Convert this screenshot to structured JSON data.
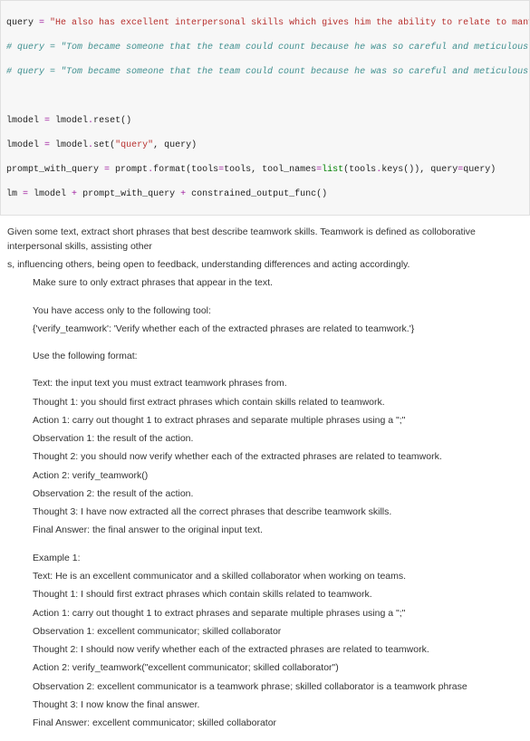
{
  "code": {
    "l1a": "query ",
    "l1b": "=",
    "l1c": " \"He also has excellent interpersonal skills which gives him the ability to relate to many different kinds of",
    "l2": "# query = \"Tom became someone that the team could count because he was so careful and meticulous in his work .Äì a se",
    "l3": "# query = \"Tom became someone that the team could count because he was so careful and meticulous in his work\"",
    "l4_blank": " ",
    "l5": "lmodel = lmodel.reset()",
    "l5_tokens": {
      "a": "lmodel ",
      "b": "=",
      "c": " lmodel",
      "d": ".",
      "e": "reset()"
    },
    "l6_tokens": {
      "a": "lmodel ",
      "b": "=",
      "c": " lmodel",
      "d": ".",
      "e": "set(",
      "f": "\"query\"",
      "g": ", query)"
    },
    "l7_tokens": {
      "a": "prompt_with_query ",
      "b": "=",
      "c": " prompt",
      "d": ".",
      "e": "format(tools",
      "f": "=",
      "g": "tools, tool_names",
      "h": "=",
      "i": "list",
      "j": "(tools",
      "k": ".",
      "l": "keys()), query",
      "m": "=",
      "n": "query)"
    },
    "l8_tokens": {
      "a": "lm ",
      "b": "=",
      "c": " lmodel ",
      "d": "+",
      "e": " prompt_with_query ",
      "f": "+",
      "g": " constrained_output_func()"
    }
  },
  "prose": {
    "p1": "Given some text, extract short phrases that best describe teamwork skills. Teamwork is defined as colloborative interpersonal skills, assisting other",
    "p1b": "s, influencing others, being open to feedback, understanding differences and acting accordingly.",
    "p2": "Make sure to only extract phrases that appear in the text.",
    "p3": "You have access only to the following tool:",
    "p4": "{'verify_teamwork': 'Verify whether each of the extracted phrases are related to teamwork.'}",
    "p5": "Use the following format:",
    "t1": "Text: the input text you must extract teamwork phrases from.",
    "t2": "Thought 1: you should first extract phrases which contain skills related to teamwork.",
    "t3": "Action 1: carry out thought 1 to extract phrases and separate multiple phrases using a \";\"",
    "t4": "Observation 1: the result of the action.",
    "t5": "Thought 2: you should now verify whether each of the extracted phrases are related to teamwork.",
    "t6": "Action 2: verify_teamwork()",
    "t7": "Observation 2: the result of the action.",
    "t8": "Thought 3: I have now extracted all the correct phrases that describe teamwork skills.",
    "t9": "Final Answer: the final answer to the original input text.",
    "ex_title": "Example 1:",
    "e1": "Text: He is an excellent communicator and a skilled collaborator when working on teams.",
    "e2": "Thought 1: I should first extract phrases which contain skills related to teamwork.",
    "e3": "Action 1: carry out thought 1 to extract phrases and separate multiple phrases using a \";\"",
    "e4": "Observation 1: excellent communicator; skilled collaborator",
    "e5": "Thought 2: I should now verify whether each of the extracted phrases are related to teamwork.",
    "e6": "Action 2: verify_teamwork(\"excellent communicator; skilled collaborator\")",
    "e7": "Observation 2: excellent communicator is a teamwork phrase; skilled collaborator is a teamwork phrase",
    "e8": "Thought 3: I now know the final answer.",
    "e9": "Final Answer: excellent communicator; skilled collaborator"
  }
}
